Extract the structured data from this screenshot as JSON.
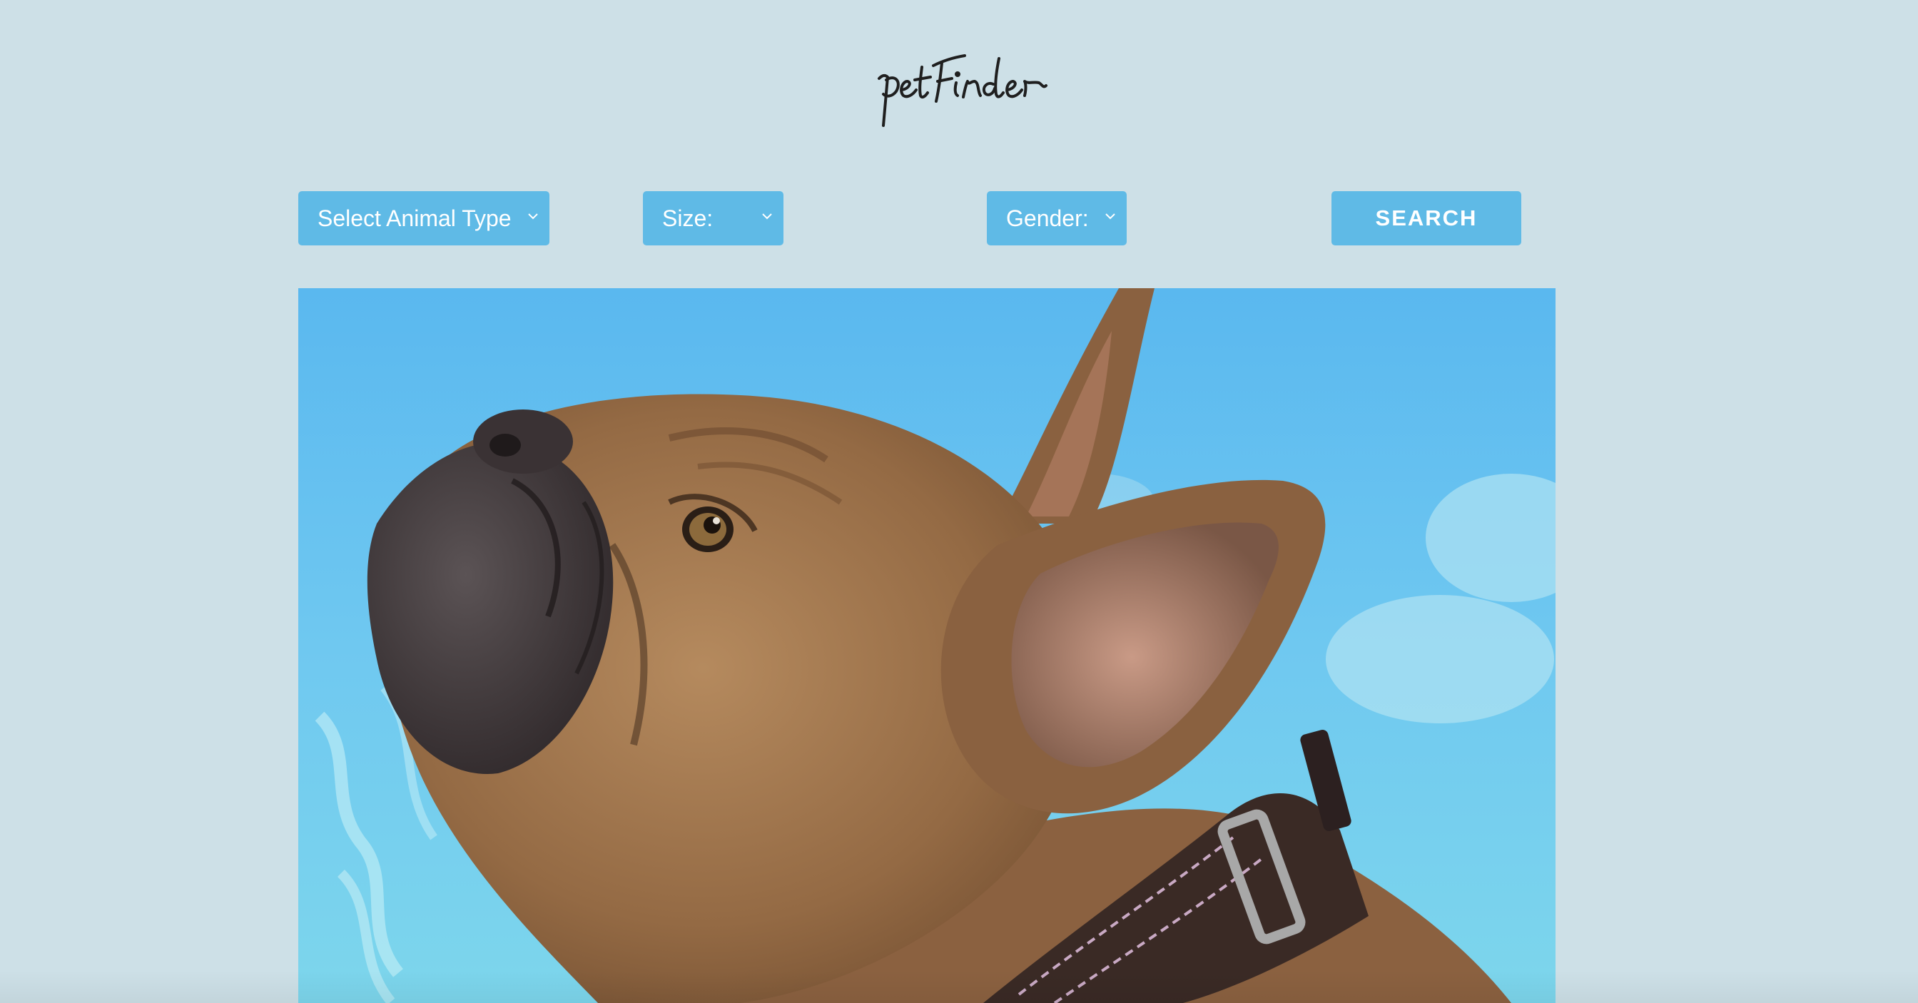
{
  "app": {
    "logo_text": "petFinder"
  },
  "filters": {
    "animal_type": {
      "selected": "Select Animal Type"
    },
    "size": {
      "selected": "Size:"
    },
    "gender": {
      "selected": "Gender:"
    }
  },
  "actions": {
    "search_label": "SEARCH"
  },
  "theme": {
    "background": "#cde0e7",
    "accent": "#5fbae6",
    "logo_color": "#1f1f1f"
  },
  "icons": {
    "dropdown": "chevron-down-icon"
  }
}
